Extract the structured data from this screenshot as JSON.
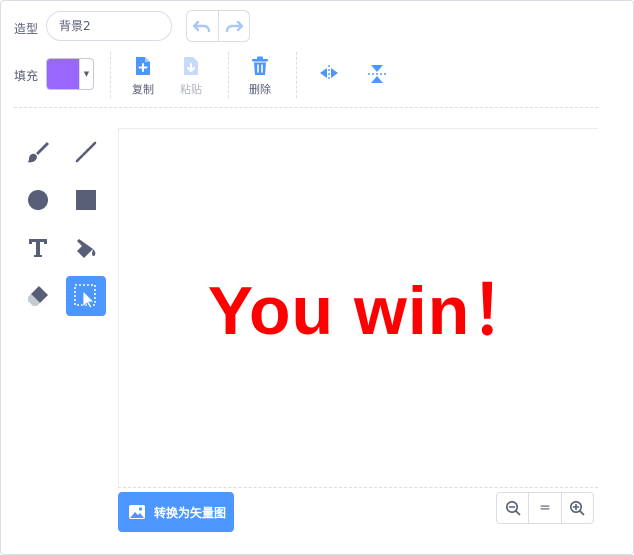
{
  "costume": {
    "label": "造型",
    "name_value": "背景2"
  },
  "history": {
    "undo_icon": "undo-icon",
    "redo_icon": "redo-icon"
  },
  "fill": {
    "label": "填充",
    "color": "#9966ff"
  },
  "toolbar": {
    "copy_label": "复制",
    "paste_label": "粘贴",
    "delete_label": "删除",
    "flip_h_icon": "flip-horizontal-icon",
    "flip_v_icon": "flip-vertical-icon",
    "accent_color": "#4c97ff"
  },
  "tools": [
    {
      "name": "brush",
      "icon": "brush-icon"
    },
    {
      "name": "line",
      "icon": "line-icon"
    },
    {
      "name": "circle",
      "icon": "circle-icon"
    },
    {
      "name": "rectangle",
      "icon": "rectangle-icon"
    },
    {
      "name": "text",
      "icon": "text-icon"
    },
    {
      "name": "fill",
      "icon": "fill-bucket-icon"
    },
    {
      "name": "eraser",
      "icon": "eraser-icon"
    },
    {
      "name": "select",
      "icon": "select-icon",
      "selected": true
    }
  ],
  "canvas": {
    "text": "You win！",
    "text_color": "#ff0000"
  },
  "convert_button": {
    "label": "转换为矢量图"
  },
  "zoom": {
    "zoom_out_icon": "zoom-out-icon",
    "reset_label": "=",
    "zoom_in_icon": "zoom-in-icon"
  }
}
